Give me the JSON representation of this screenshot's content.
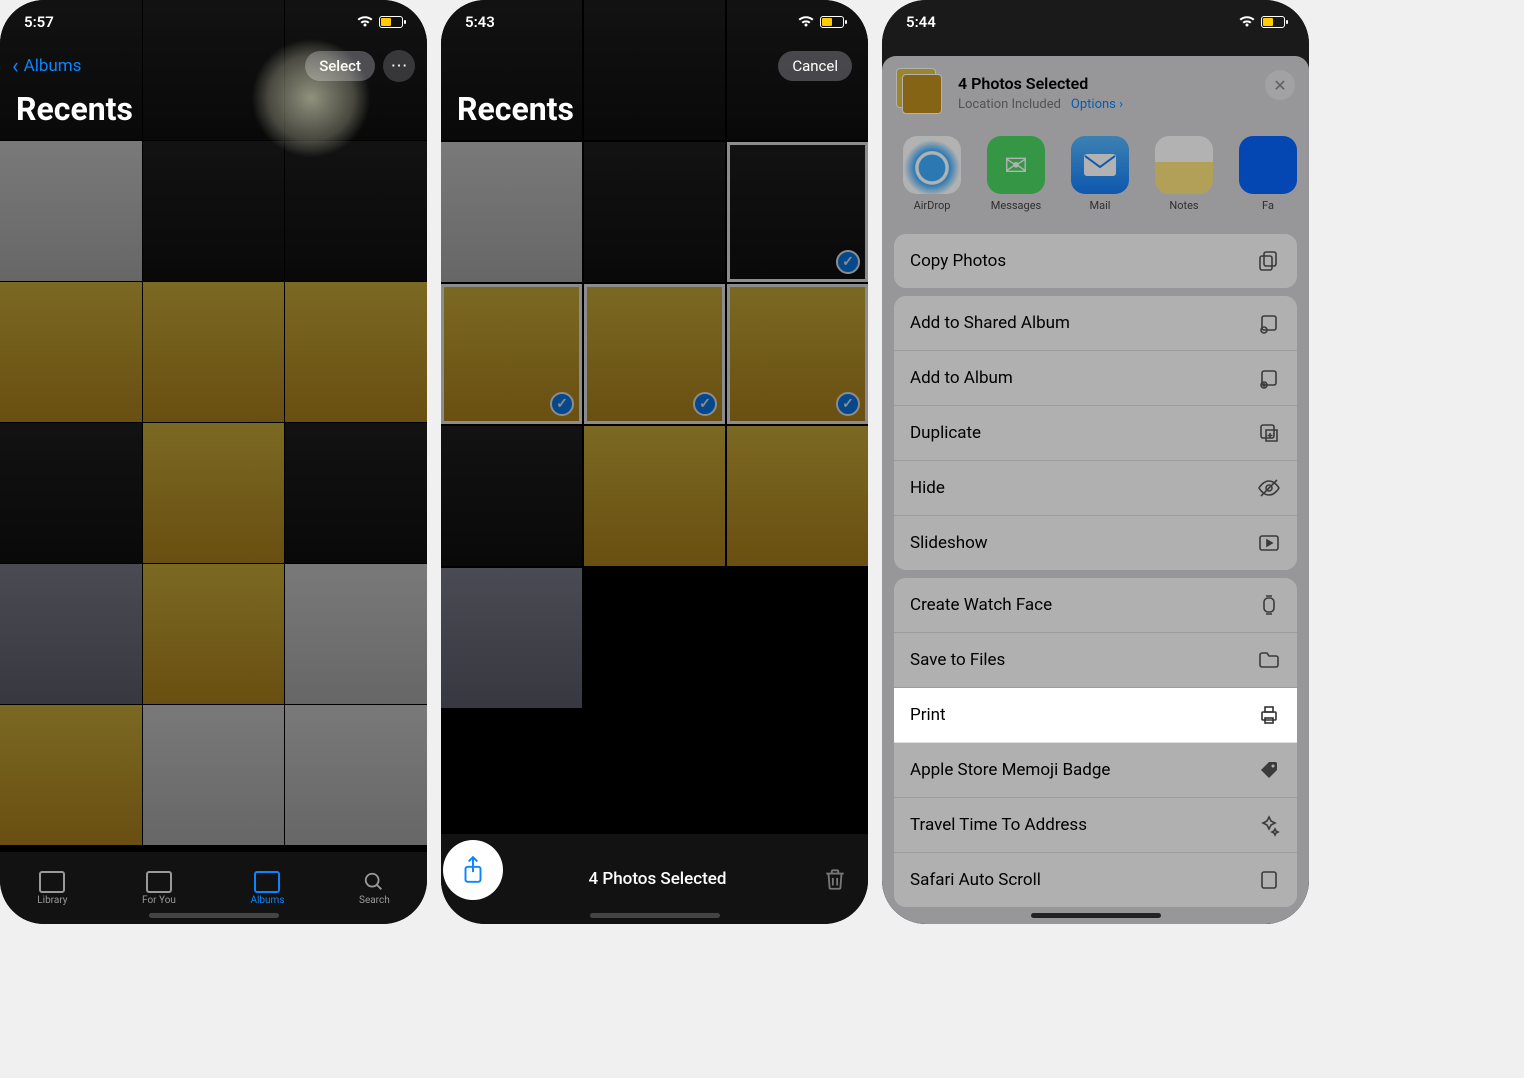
{
  "screen1": {
    "time": "5:57",
    "back_label": "Albums",
    "select_label": "Select",
    "title": "Recents",
    "tabs": {
      "library": "Library",
      "foryou": "For You",
      "albums": "Albums",
      "search": "Search"
    }
  },
  "screen2": {
    "time": "5:43",
    "title": "Recents",
    "cancel_label": "Cancel",
    "selected_text": "4 Photos Selected"
  },
  "screen3": {
    "time": "5:44",
    "sheet_title": "4 Photos Selected",
    "sheet_subtitle": "Location Included",
    "options_label": "Options",
    "apps": {
      "airdrop": "AirDrop",
      "messages": "Messages",
      "mail": "Mail",
      "notes": "Notes",
      "facebook": "Fa"
    },
    "actions": {
      "copy": "Copy Photos",
      "shared_album": "Add to Shared Album",
      "album": "Add to Album",
      "duplicate": "Duplicate",
      "hide": "Hide",
      "slideshow": "Slideshow",
      "watchface": "Create Watch Face",
      "savefiles": "Save to Files",
      "print": "Print",
      "memoji": "Apple Store Memoji Badge",
      "travel": "Travel Time To Address",
      "safari": "Safari Auto Scroll"
    }
  }
}
